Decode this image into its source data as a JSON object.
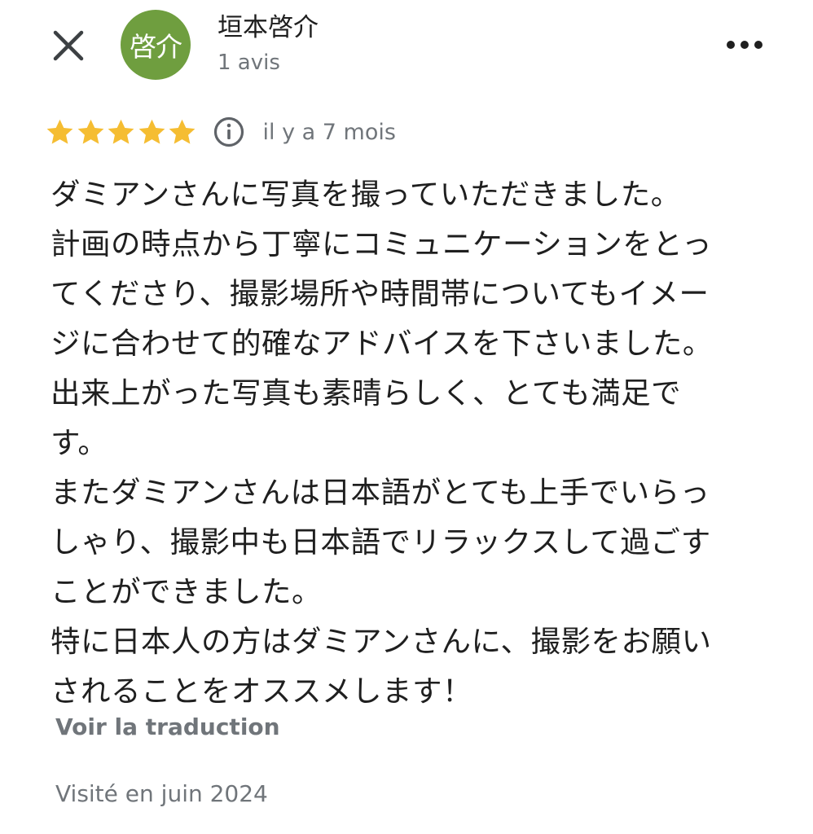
{
  "reviewer": {
    "avatar_text": "啓介",
    "avatar_color": "#6f9e3f",
    "name": "垣本啓介",
    "review_count": "1 avis"
  },
  "icons": {
    "close": "close-icon",
    "more": "more-horizontal-icon",
    "info": "info-icon",
    "star": "star-icon"
  },
  "rating": {
    "stars": 5,
    "max_stars": 5,
    "star_color": "#f5bd32",
    "time_ago": "il y a 7 mois"
  },
  "review": {
    "lines": [
      "ダミアンさんに写真を撮っていただきました。",
      "計画の時点から丁寧にコミュニケーションをとっ",
      "てくださり、撮影場所や時間帯についてもイメー",
      "ジに合わせて的確なアドバイスを下さいました。",
      "出来上がった写真も素晴らしく、とても満足で",
      "す。",
      "またダミアンさんは日本語がとても上手でいらっ",
      "しゃり、撮影中も日本語でリラックスして過ごす",
      "ことができました。",
      "特に日本人の方はダミアンさんに、撮影をお願い",
      "されることをオススメします！"
    ]
  },
  "translate_label": "Voir la traduction",
  "visit_date": "Visité en juin 2024"
}
